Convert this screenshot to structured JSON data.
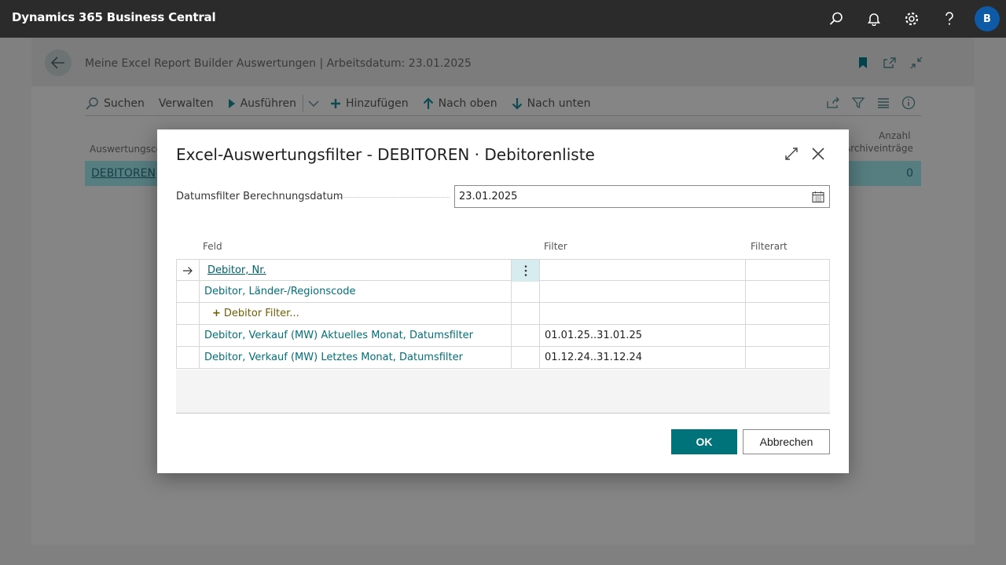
{
  "app": {
    "title": "Dynamics 365 Business Central",
    "user_initial": "B"
  },
  "page": {
    "title": "Meine Excel Report Builder Auswertungen | Arbeitsdatum: 23.01.2025",
    "actions": {
      "search": "Suchen",
      "manage": "Verwalten",
      "run": "Ausführen",
      "add": "Hinzufügen",
      "move_up": "Nach oben",
      "move_down": "Nach unten"
    },
    "columns": {
      "code": "Auswertungscode",
      "count_line1": "Anzahl",
      "count_line2": "Archiveinträge"
    },
    "row": {
      "code": "DEBITOREN",
      "count": "0"
    }
  },
  "dialog": {
    "title": "Excel-Auswertungsfilter - DEBITOREN · Debitorenliste",
    "date_filter": {
      "label": "Datumsfilter Berechnungsdatum",
      "value": "23.01.2025"
    },
    "grid": {
      "headers": {
        "field": "Feld",
        "filter": "Filter",
        "filter_type": "Filterart"
      },
      "rows": [
        {
          "field": "Debitor, Nr.",
          "filter": "",
          "filter_type": ""
        },
        {
          "field": "Debitor, Länder-/Regionscode",
          "filter": "",
          "filter_type": ""
        },
        {
          "field": "Debitor Filter...",
          "filter": "",
          "filter_type": ""
        },
        {
          "field": "Debitor, Verkauf (MW) Aktuelles Monat, Datumsfilter",
          "filter": "01.01.25..31.01.25",
          "filter_type": ""
        },
        {
          "field": "Debitor, Verkauf (MW) Letztes Monat, Datumsfilter",
          "filter": "01.12.24..31.12.24",
          "filter_type": ""
        }
      ]
    },
    "buttons": {
      "ok": "OK",
      "cancel": "Abbrechen"
    }
  }
}
